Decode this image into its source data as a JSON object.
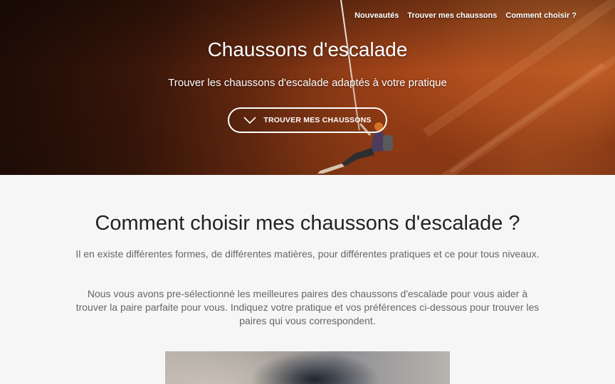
{
  "nav": {
    "items": [
      {
        "label": "Nouveautés"
      },
      {
        "label": "Trouver mes chaussons"
      },
      {
        "label": "Comment choisir ?"
      }
    ]
  },
  "hero": {
    "title": "Chaussons d'escalade",
    "subtitle": "Trouver les chaussons d'escalade adaptés à votre pratique",
    "cta_label": "TROUVER MES CHAUSSONS",
    "cta_icon": "chevron-down-icon"
  },
  "section": {
    "title": "Comment choisir mes chaussons d'escalade ?",
    "paragraph1": "Il en existe différentes formes, de différentes matières, pour différentes pratiques et ce pour tous niveaux.",
    "paragraph2": "Nous vous avons pre-sélectionné les meilleures paires des chaussons d'escalade pour vous aider à trouver la paire parfaite pour vous. Indiquez votre pratique et vos préférences ci-dessous pour trouver les paires qui vous correspondent."
  },
  "colors": {
    "page_background": "#f6f6f6",
    "hero_rock": "#a7481b",
    "title_text": "#222222",
    "body_text": "#666666"
  }
}
